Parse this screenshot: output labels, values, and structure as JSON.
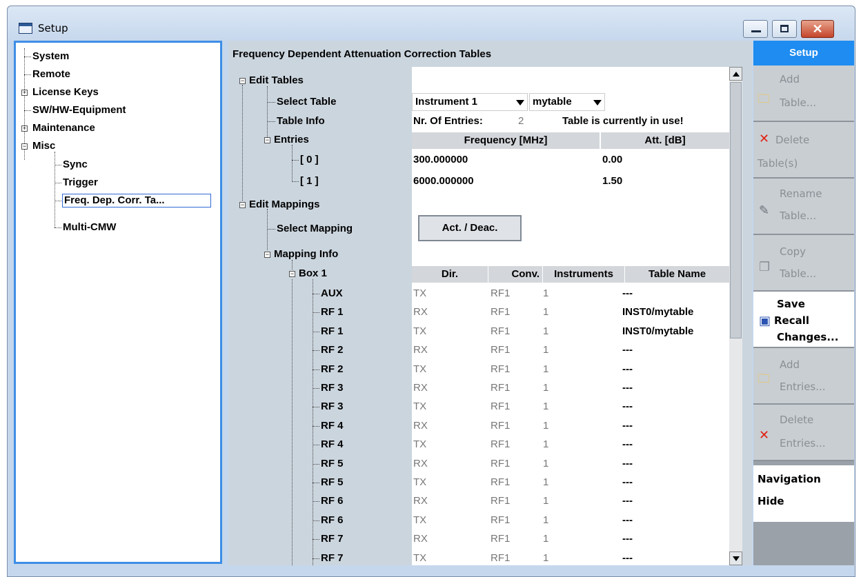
{
  "window": {
    "title": "Setup",
    "close_glyph": "✕"
  },
  "nav_tree": {
    "items": [
      {
        "label": "System"
      },
      {
        "label": "Remote"
      },
      {
        "label": "License Keys"
      },
      {
        "label": "SW/HW-Equipment"
      },
      {
        "label": "Maintenance"
      },
      {
        "label": "Misc"
      },
      {
        "label": "Sync"
      },
      {
        "label": "Trigger"
      },
      {
        "label": "Freq. Dep. Corr. Ta..."
      },
      {
        "label": "Multi-CMW"
      }
    ],
    "expander_plus": "+",
    "expander_minus": "−"
  },
  "main": {
    "title": "Frequency Dependent Attenuation Correction Tables",
    "tree": {
      "edit_tables": "Edit Tables",
      "select_table": "Select Table",
      "table_info": "Table Info",
      "entries": "Entries",
      "entry0": "[ 0 ]",
      "entry1": "[ 1 ]",
      "edit_mappings": "Edit Mappings",
      "select_mapping": "Select Mapping",
      "mapping_info": "Mapping Info",
      "box1": "Box 1"
    },
    "select_table": {
      "instrument": "Instrument 1",
      "table": "mytable"
    },
    "table_info": {
      "label": "Nr. Of Entries:",
      "count": "2",
      "status": "Table is currently in use!"
    },
    "entries_headers": {
      "frequency": "Frequency [MHz]",
      "att": "Att. [dB]"
    },
    "entries": [
      {
        "frequency": "300.000000",
        "att": "0.00"
      },
      {
        "frequency": "6000.000000",
        "att": "1.50"
      }
    ],
    "act_button": "Act. / Deac.",
    "mapping_headers": {
      "dir": "Dir.",
      "conv": "Conv.",
      "instruments": "Instruments",
      "table_name": "Table Name"
    },
    "mappings": [
      {
        "conn": "AUX",
        "dir": "TX",
        "conv": "RF1",
        "inst": "1",
        "table": "---"
      },
      {
        "conn": "RF 1",
        "dir": "RX",
        "conv": "RF1",
        "inst": "1",
        "table": "INST0/mytable"
      },
      {
        "conn": "RF 1",
        "dir": "TX",
        "conv": "RF1",
        "inst": "1",
        "table": "INST0/mytable"
      },
      {
        "conn": "RF 2",
        "dir": "RX",
        "conv": "RF1",
        "inst": "1",
        "table": "---"
      },
      {
        "conn": "RF 2",
        "dir": "TX",
        "conv": "RF1",
        "inst": "1",
        "table": "---"
      },
      {
        "conn": "RF 3",
        "dir": "RX",
        "conv": "RF1",
        "inst": "1",
        "table": "---"
      },
      {
        "conn": "RF 3",
        "dir": "TX",
        "conv": "RF1",
        "inst": "1",
        "table": "---"
      },
      {
        "conn": "RF 4",
        "dir": "RX",
        "conv": "RF1",
        "inst": "1",
        "table": "---"
      },
      {
        "conn": "RF 4",
        "dir": "TX",
        "conv": "RF1",
        "inst": "1",
        "table": "---"
      },
      {
        "conn": "RF 5",
        "dir": "RX",
        "conv": "RF1",
        "inst": "1",
        "table": "---"
      },
      {
        "conn": "RF 5",
        "dir": "TX",
        "conv": "RF1",
        "inst": "1",
        "table": "---"
      },
      {
        "conn": "RF 6",
        "dir": "RX",
        "conv": "RF1",
        "inst": "1",
        "table": "---"
      },
      {
        "conn": "RF 6",
        "dir": "TX",
        "conv": "RF1",
        "inst": "1",
        "table": "---"
      },
      {
        "conn": "RF 7",
        "dir": "RX",
        "conv": "RF1",
        "inst": "1",
        "table": "---"
      },
      {
        "conn": "RF 7",
        "dir": "TX",
        "conv": "RF1",
        "inst": "1",
        "table": "---"
      }
    ]
  },
  "softkeys": {
    "header": "Setup",
    "keys": [
      {
        "line1": "Add",
        "line2": "Table...",
        "icon": "folder-add-icon"
      },
      {
        "line1": "Delete",
        "line2": "Table(s)",
        "icon": "delete-x-icon"
      },
      {
        "line1": "Rename",
        "line2": "Table...",
        "icon": "rename-icon"
      },
      {
        "line1": "Copy",
        "line2": "Table...",
        "icon": "copy-icon"
      },
      {
        "line1": "Save",
        "line2": "Recall",
        "line3": "Changes...",
        "icon": "save-icon"
      },
      {
        "line1": "Add",
        "line2": "Entries...",
        "icon": "folder-add-icon"
      },
      {
        "line1": "Delete",
        "line2": "Entries...",
        "icon": "delete-x-icon"
      }
    ],
    "navigation": "Navigation",
    "hide": "Hide"
  },
  "colors": {
    "accent": "#1e8cf0",
    "delete_red": "#e02010",
    "folder_yellow": "#f2c53a"
  }
}
